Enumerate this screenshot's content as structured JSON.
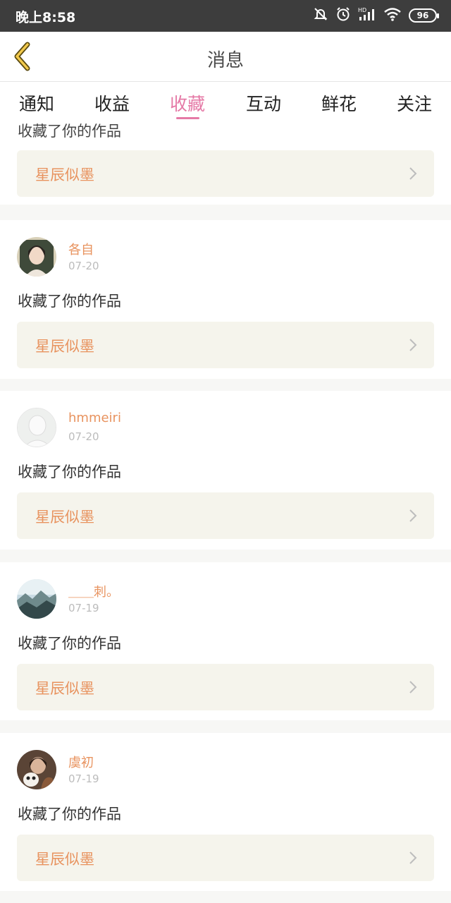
{
  "status_bar": {
    "time": "晚上8:58",
    "battery": "96",
    "icons": [
      "mute-icon",
      "alarm-icon",
      "hd-signal-icon",
      "wifi-icon",
      "battery-icon"
    ]
  },
  "header": {
    "title": "消息"
  },
  "tabs": [
    {
      "label": "通知",
      "active": false
    },
    {
      "label": "收益",
      "active": false
    },
    {
      "label": "收藏",
      "active": true
    },
    {
      "label": "互动",
      "active": false
    },
    {
      "label": "鲜花",
      "active": false
    },
    {
      "label": "关注",
      "active": false
    }
  ],
  "partial_top": {
    "action": "收藏了你的作品",
    "work_title": "星辰似墨"
  },
  "items": [
    {
      "username": "各自",
      "date": "07-20",
      "action": "收藏了你的作品",
      "work_title": "星辰似墨"
    },
    {
      "username": "hmmeiri",
      "date": "07-20",
      "action": "收藏了你的作品",
      "work_title": "星辰似墨"
    },
    {
      "username": "＿＿刺。",
      "date": "07-19",
      "action": "收藏了你的作品",
      "work_title": "星辰似墨"
    },
    {
      "username": "虞初",
      "date": "07-19",
      "action": "收藏了你的作品",
      "work_title": "星辰似墨"
    }
  ],
  "colors": {
    "accent": "#e579a6",
    "username": "#e8935f",
    "work_box_bg": "#f5f4ec",
    "status_bar_bg": "#3d3d3d"
  }
}
